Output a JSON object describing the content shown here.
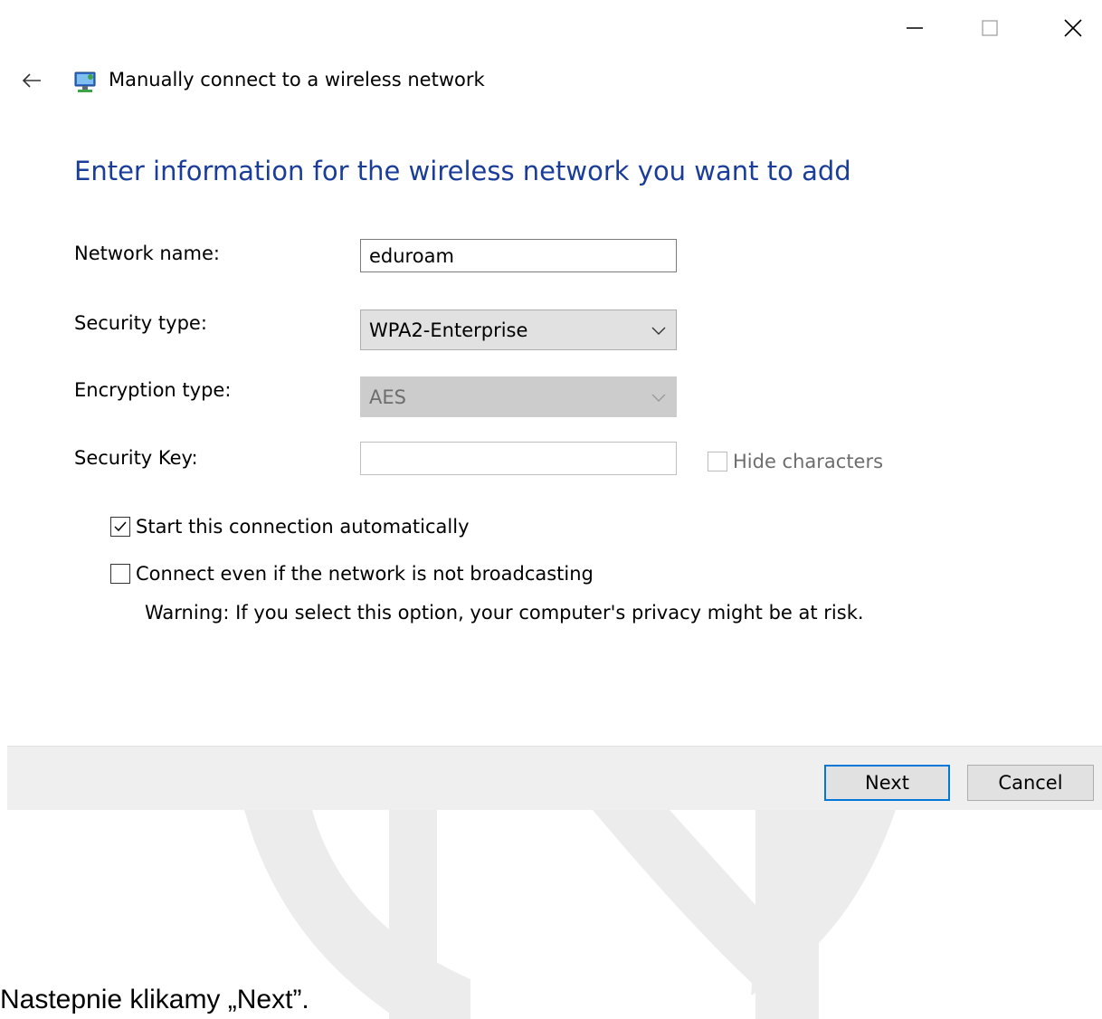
{
  "window": {
    "title": "Manually connect to a wireless network",
    "heading": "Enter information for the wireless network you want to add"
  },
  "controls": {
    "minimize": "minimize-icon",
    "maximize": "maximize-icon",
    "close": "close-icon",
    "back": "back-arrow-icon"
  },
  "form": {
    "network_name_label": "Network name:",
    "network_name_value": "eduroam",
    "security_type_label": "Security type:",
    "security_type_value": "WPA2-Enterprise",
    "encryption_type_label": "Encryption type:",
    "encryption_type_value": "AES",
    "security_key_label": "Security Key:",
    "security_key_value": "",
    "hide_characters_label": "Hide characters",
    "hide_characters_checked": false,
    "hide_characters_enabled": false
  },
  "options": {
    "start_auto_label": "Start this connection automatically",
    "start_auto_checked": true,
    "connect_hidden_label": "Connect even if the network is not broadcasting",
    "connect_hidden_checked": false,
    "warning_text": "Warning: If you select this option, your computer's privacy might be at risk."
  },
  "footer": {
    "next_label": "Next",
    "cancel_label": "Cancel"
  },
  "caption": "Nastepnie klikamy „Next”.",
  "colors": {
    "heading": "#1a3d99",
    "accent_border": "#0078d7",
    "footer_bg": "#efefef"
  }
}
